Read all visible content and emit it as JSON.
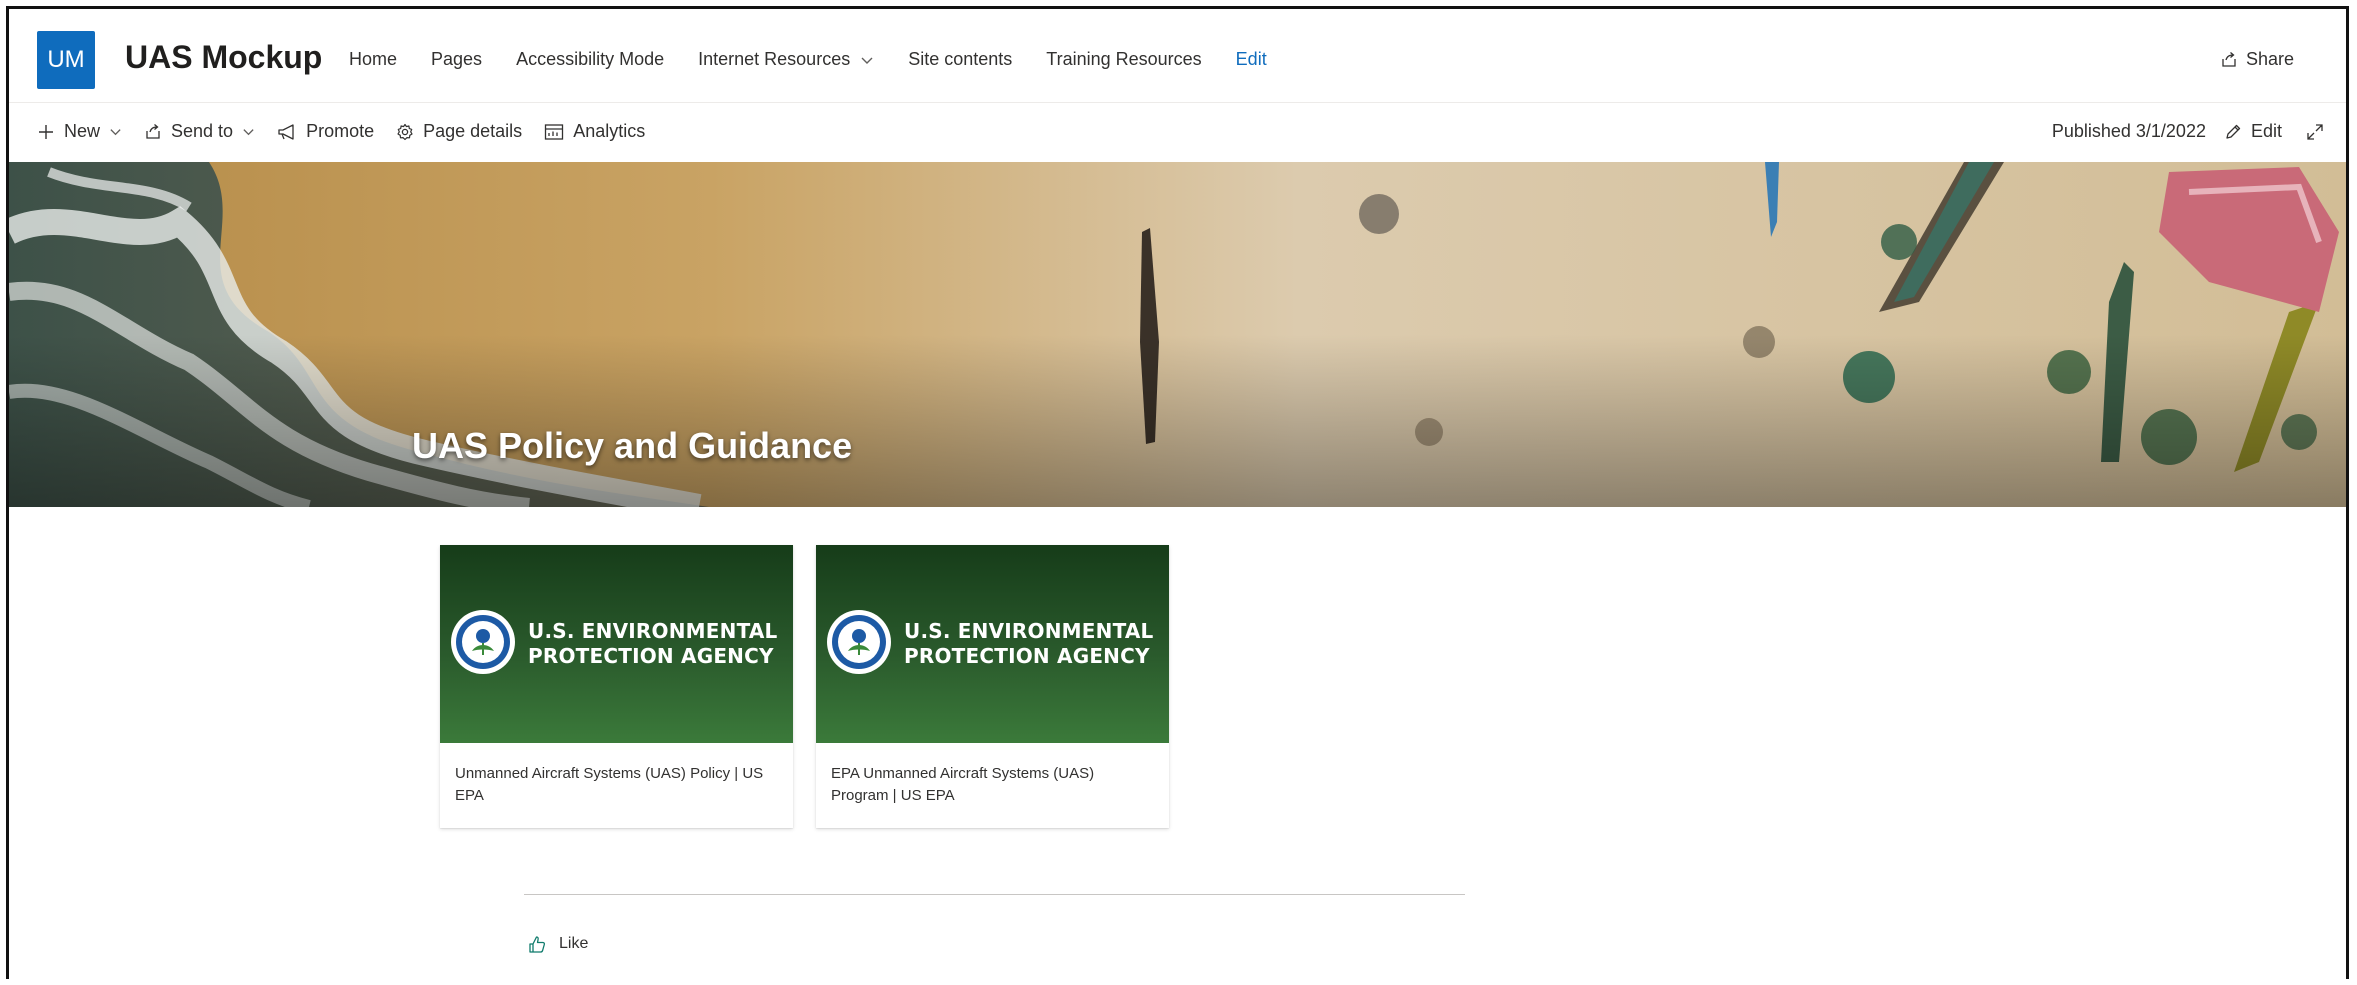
{
  "site": {
    "logo_initials": "UM",
    "title": "UAS Mockup",
    "brand_color": "#0f6cbd"
  },
  "nav": {
    "items": [
      {
        "label": "Home"
      },
      {
        "label": "Pages"
      },
      {
        "label": "Accessibility Mode"
      },
      {
        "label": "Internet Resources",
        "dropdown": true
      },
      {
        "label": "Site contents"
      },
      {
        "label": "Training Resources"
      },
      {
        "label": "Edit"
      }
    ],
    "share_label": "Share"
  },
  "command_bar": {
    "new_label": "New",
    "send_to_label": "Send to",
    "promote_label": "Promote",
    "page_details_label": "Page details",
    "analytics_label": "Analytics",
    "published_label": "Published 3/1/2022",
    "edit_label": "Edit"
  },
  "hero": {
    "title": "UAS Policy and Guidance"
  },
  "quick_links": [
    {
      "image_line1": "U.S. ENVIRONMENTAL",
      "image_line2": "PROTECTION AGENCY",
      "caption": "Unmanned Aircraft Systems (UAS) Policy | US EPA"
    },
    {
      "image_line1": "U.S. ENVIRONMENTAL",
      "image_line2": "PROTECTION AGENCY",
      "caption": "EPA Unmanned Aircraft Systems (UAS) Program | US EPA"
    }
  ],
  "social": {
    "like_label": "Like"
  },
  "icons": {
    "new": "plus-icon",
    "send_to": "share-arrow-icon",
    "promote": "megaphone-icon",
    "page_details": "gear-icon",
    "analytics": "analytics-icon",
    "edit": "pencil-icon",
    "expand": "expand-icon",
    "share": "share-icon",
    "like": "thumbs-up-icon"
  }
}
